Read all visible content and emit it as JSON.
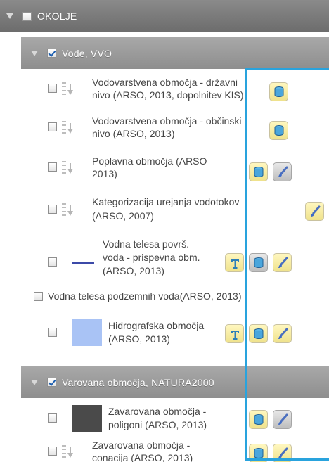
{
  "group": {
    "label": "OKOLJE",
    "checked": false
  },
  "subgroups": [
    {
      "label": "Vode, VVO",
      "checked": true
    },
    {
      "label": "Varovana območja, NATURA2000",
      "checked": true
    }
  ],
  "layers": [
    {
      "lines": [
        "Vodovarstvena območja - državni",
        "nivo (ARSO, 2013, dopolnitev KIS)"
      ],
      "legend": "drag-handle",
      "buttons": [
        "database-icon"
      ]
    },
    {
      "lines": [
        "Vodovarstvena območja - občinski",
        "nivo (ARSO, 2013)"
      ],
      "legend": "drag-handle",
      "buttons": [
        "database-icon"
      ]
    },
    {
      "lines": [
        "Poplavna območja (ARSO",
        "2013)"
      ],
      "legend": "drag-handle",
      "buttons": [
        "database-icon",
        "brush-icon"
      ]
    },
    {
      "lines": [
        "Kategorizacija urejanja vodotokov",
        "(ARSO, 2007)"
      ],
      "legend": "drag-handle",
      "buttons": [
        "brush-icon"
      ]
    },
    {
      "lines": [
        "Vodna telesa površ.",
        "voda - prispevna obm.",
        "(ARSO, 2013)"
      ],
      "legend": "line",
      "legend_color": "#3c4aa8",
      "buttons": [
        "text-style-icon",
        "database-icon",
        "brush-icon"
      ]
    },
    {
      "lines": [
        "Vodna telesa podzemnih voda(ARSO, 2013)"
      ],
      "legend": "none",
      "buttons": []
    },
    {
      "lines": [
        "Hidrografska območja",
        "(ARSO, 2013)"
      ],
      "legend": "swatch",
      "legend_color": "#a9c3f5",
      "buttons": [
        "text-style-icon",
        "database-icon",
        "brush-icon"
      ]
    },
    {
      "lines": [
        "Zavarovana območja -",
        "poligoni (ARSO, 2013)"
      ],
      "legend": "swatch",
      "legend_color": "#4a4a4a",
      "buttons": [
        "database-icon",
        "brush-icon"
      ]
    },
    {
      "lines": [
        "Zavarovana območja -",
        "conacija (ARSO, 2013)"
      ],
      "legend": "drag-handle",
      "buttons": [
        "database-icon",
        "brush-icon"
      ]
    }
  ],
  "colors": {
    "header": "#7a7a7a",
    "selection": "#29a3dd",
    "button_yellow": "#f5eaa0"
  }
}
